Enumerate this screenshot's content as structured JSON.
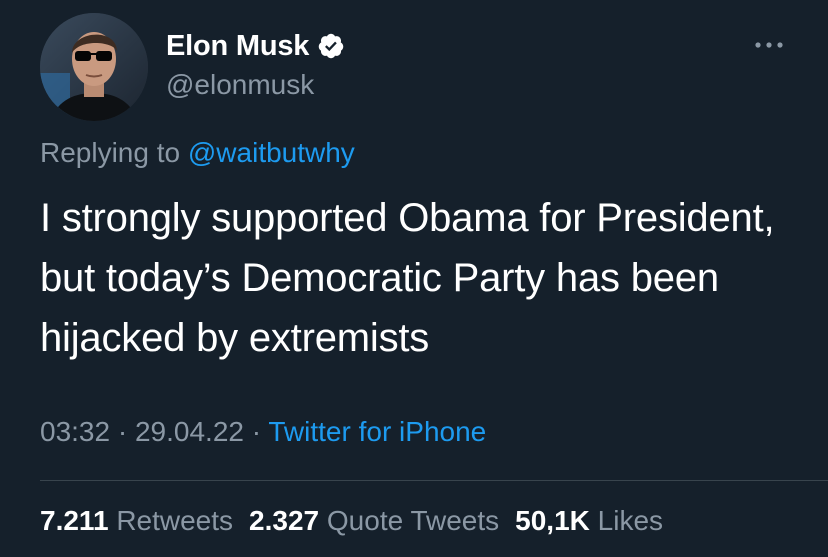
{
  "user": {
    "display_name": "Elon Musk",
    "handle": "@elonmusk",
    "verified_icon": "verified-badge-icon"
  },
  "reply": {
    "prefix": "Replying to ",
    "mention": "@waitbutwhy"
  },
  "tweet": {
    "text": "I strongly supported Obama for President, but today’s Democratic Party has been hijacked by extremists"
  },
  "meta": {
    "time": "03:32",
    "separator": " · ",
    "date": "29.04.22",
    "source": "Twitter for iPhone"
  },
  "stats": {
    "retweets_count": "7.211",
    "retweets_label": "Retweets",
    "quotes_count": "2.327",
    "quotes_label": "Quote Tweets",
    "likes_count": "50,1K",
    "likes_label": "Likes"
  },
  "colors": {
    "background": "#15202b",
    "text_primary": "#ffffff",
    "text_secondary": "#8b98a5",
    "accent": "#1d9bf0",
    "divider": "#38444d"
  }
}
